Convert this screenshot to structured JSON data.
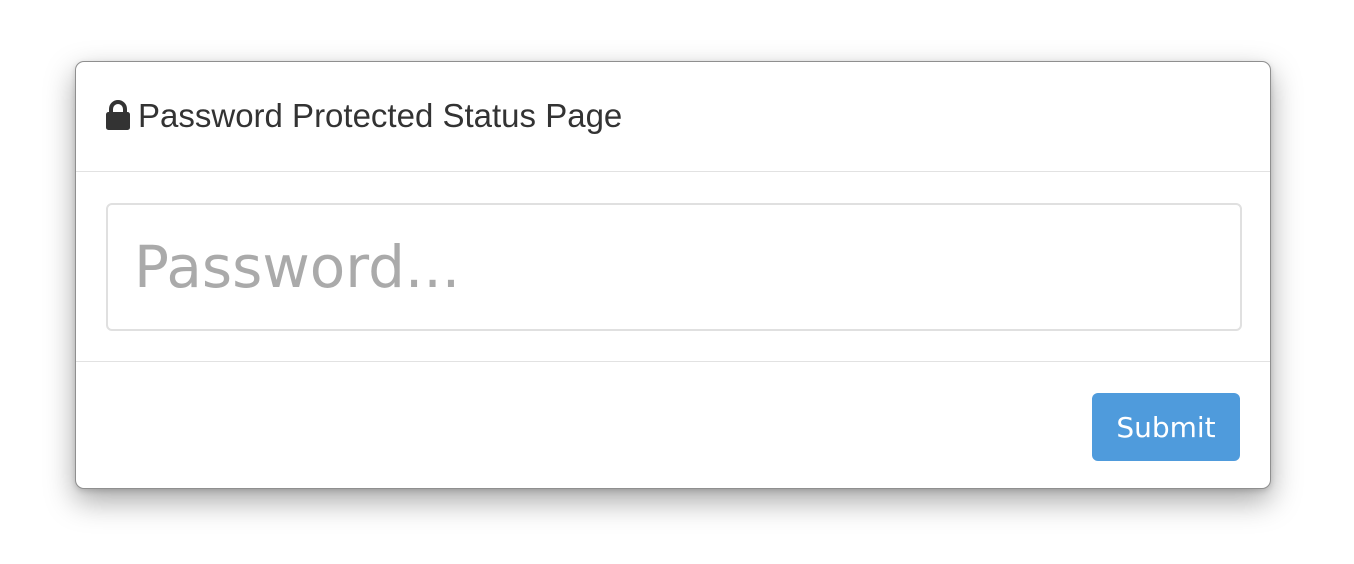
{
  "modal": {
    "title": "Password Protected Status Page",
    "title_icon": "lock-icon",
    "password_field": {
      "value": "",
      "placeholder": "Password..."
    },
    "submit_label": "Submit"
  },
  "colors": {
    "accent": "#4f9bdc",
    "title_text": "#333333",
    "placeholder_text": "#aaaaaa",
    "divider": "#e2e2e2"
  }
}
